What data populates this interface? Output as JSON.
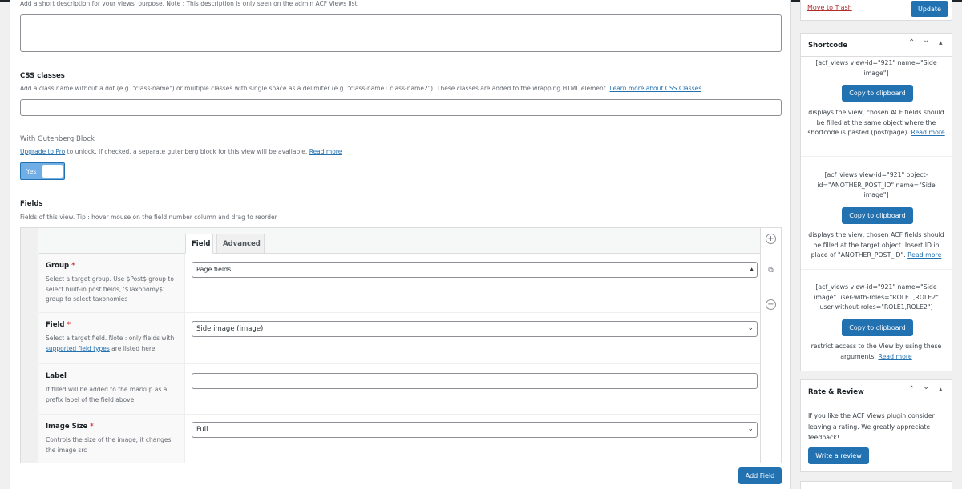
{
  "description": {
    "help": "Add a short description for your views' purpose. Note : This description is only seen on the admin ACF Views list"
  },
  "css_classes": {
    "title": "CSS classes",
    "help": "Add a class name without a dot (e.g. \"class-name\") or multiple classes with single space as a delimiter (e.g. \"class-name1 class-name2\"). These classes are added to the wrapping HTML element.",
    "link": "Learn more about CSS Classes",
    "value": ""
  },
  "gutenberg": {
    "title": "With Gutenberg Block",
    "upgrade_link": "Upgrade to Pro",
    "help": " to unlock. If checked, a separate gutenberg block for this view will be available.",
    "read_more": "Read more",
    "toggle_label": "Yes"
  },
  "fields": {
    "title": "Fields",
    "help": "Fields of this view. Tip : hover mouse on the field number column and drag to reorder",
    "row_number": "1",
    "tabs": [
      "Field",
      "Advanced"
    ],
    "controls": {
      "add": "+",
      "duplicate": "⧉",
      "remove": "−"
    },
    "group": {
      "label": "Group",
      "required": "*",
      "help": "Select a target group. Use $Post$ group to select built-in post fields, '$Taxonomy$' group to select taxonomies",
      "value": "Page fields"
    },
    "field": {
      "label": "Field",
      "required": "*",
      "help_before": "Select a target field. Note : only fields with ",
      "help_link": "supported field types",
      "help_after": " are listed here",
      "value": "Side image (image)"
    },
    "label": {
      "label": "Label",
      "help": "If filled will be added to the markup as a prefix label of the field above",
      "value": ""
    },
    "image_size": {
      "label": "Image Size",
      "required": "*",
      "help": "Controls the size of the image, it changes the image src",
      "value": "Full"
    },
    "add_button": "Add Field"
  },
  "publish": {
    "trash_link": "Move to Trash",
    "update_button": "Update"
  },
  "shortcode": {
    "title": "Shortcode",
    "block1_code": "[acf_views view-id=\"921\" name=\"Side image\"]",
    "block1_button": "Copy to clipboard",
    "block1_desc": "displays the view, chosen ACF fields should be filled at the same object where the shortcode is pasted (post/page).",
    "block1_link": "Read more",
    "block2_code": "[acf_views view-id=\"921\" object-id=\"ANOTHER_POST_ID\" name=\"Side image\"]",
    "block2_button": "Copy to clipboard",
    "block2_desc": "displays the view, chosen ACF fields should be filled at the target object. Insert ID in place of \"ANOTHER_POST_ID\".",
    "block2_link": "Read more",
    "block3_code": "[acf_views view-id=\"921\" name=\"Side image\" user-with-roles=\"ROLE1,ROLE2\" user-without-roles=\"ROLE1,ROLE2\"]",
    "block3_button": "Copy to clipboard",
    "block3_desc": "restrict access to the View by using these arguments.",
    "block3_link": "Read more"
  },
  "rate": {
    "title": "Rate & Review",
    "text": "If you like the ACF Views plugin consider leaving a rating. We greatly appreciate feedback!",
    "button": "Write a review"
  },
  "box_controls": {
    "up": "⌃",
    "down": "⌄",
    "toggle": "▴"
  },
  "colors": {
    "accent": "#2271b1",
    "toggle_on": "#72aee6",
    "required": "#d63638",
    "trash": "#b32d2e"
  }
}
